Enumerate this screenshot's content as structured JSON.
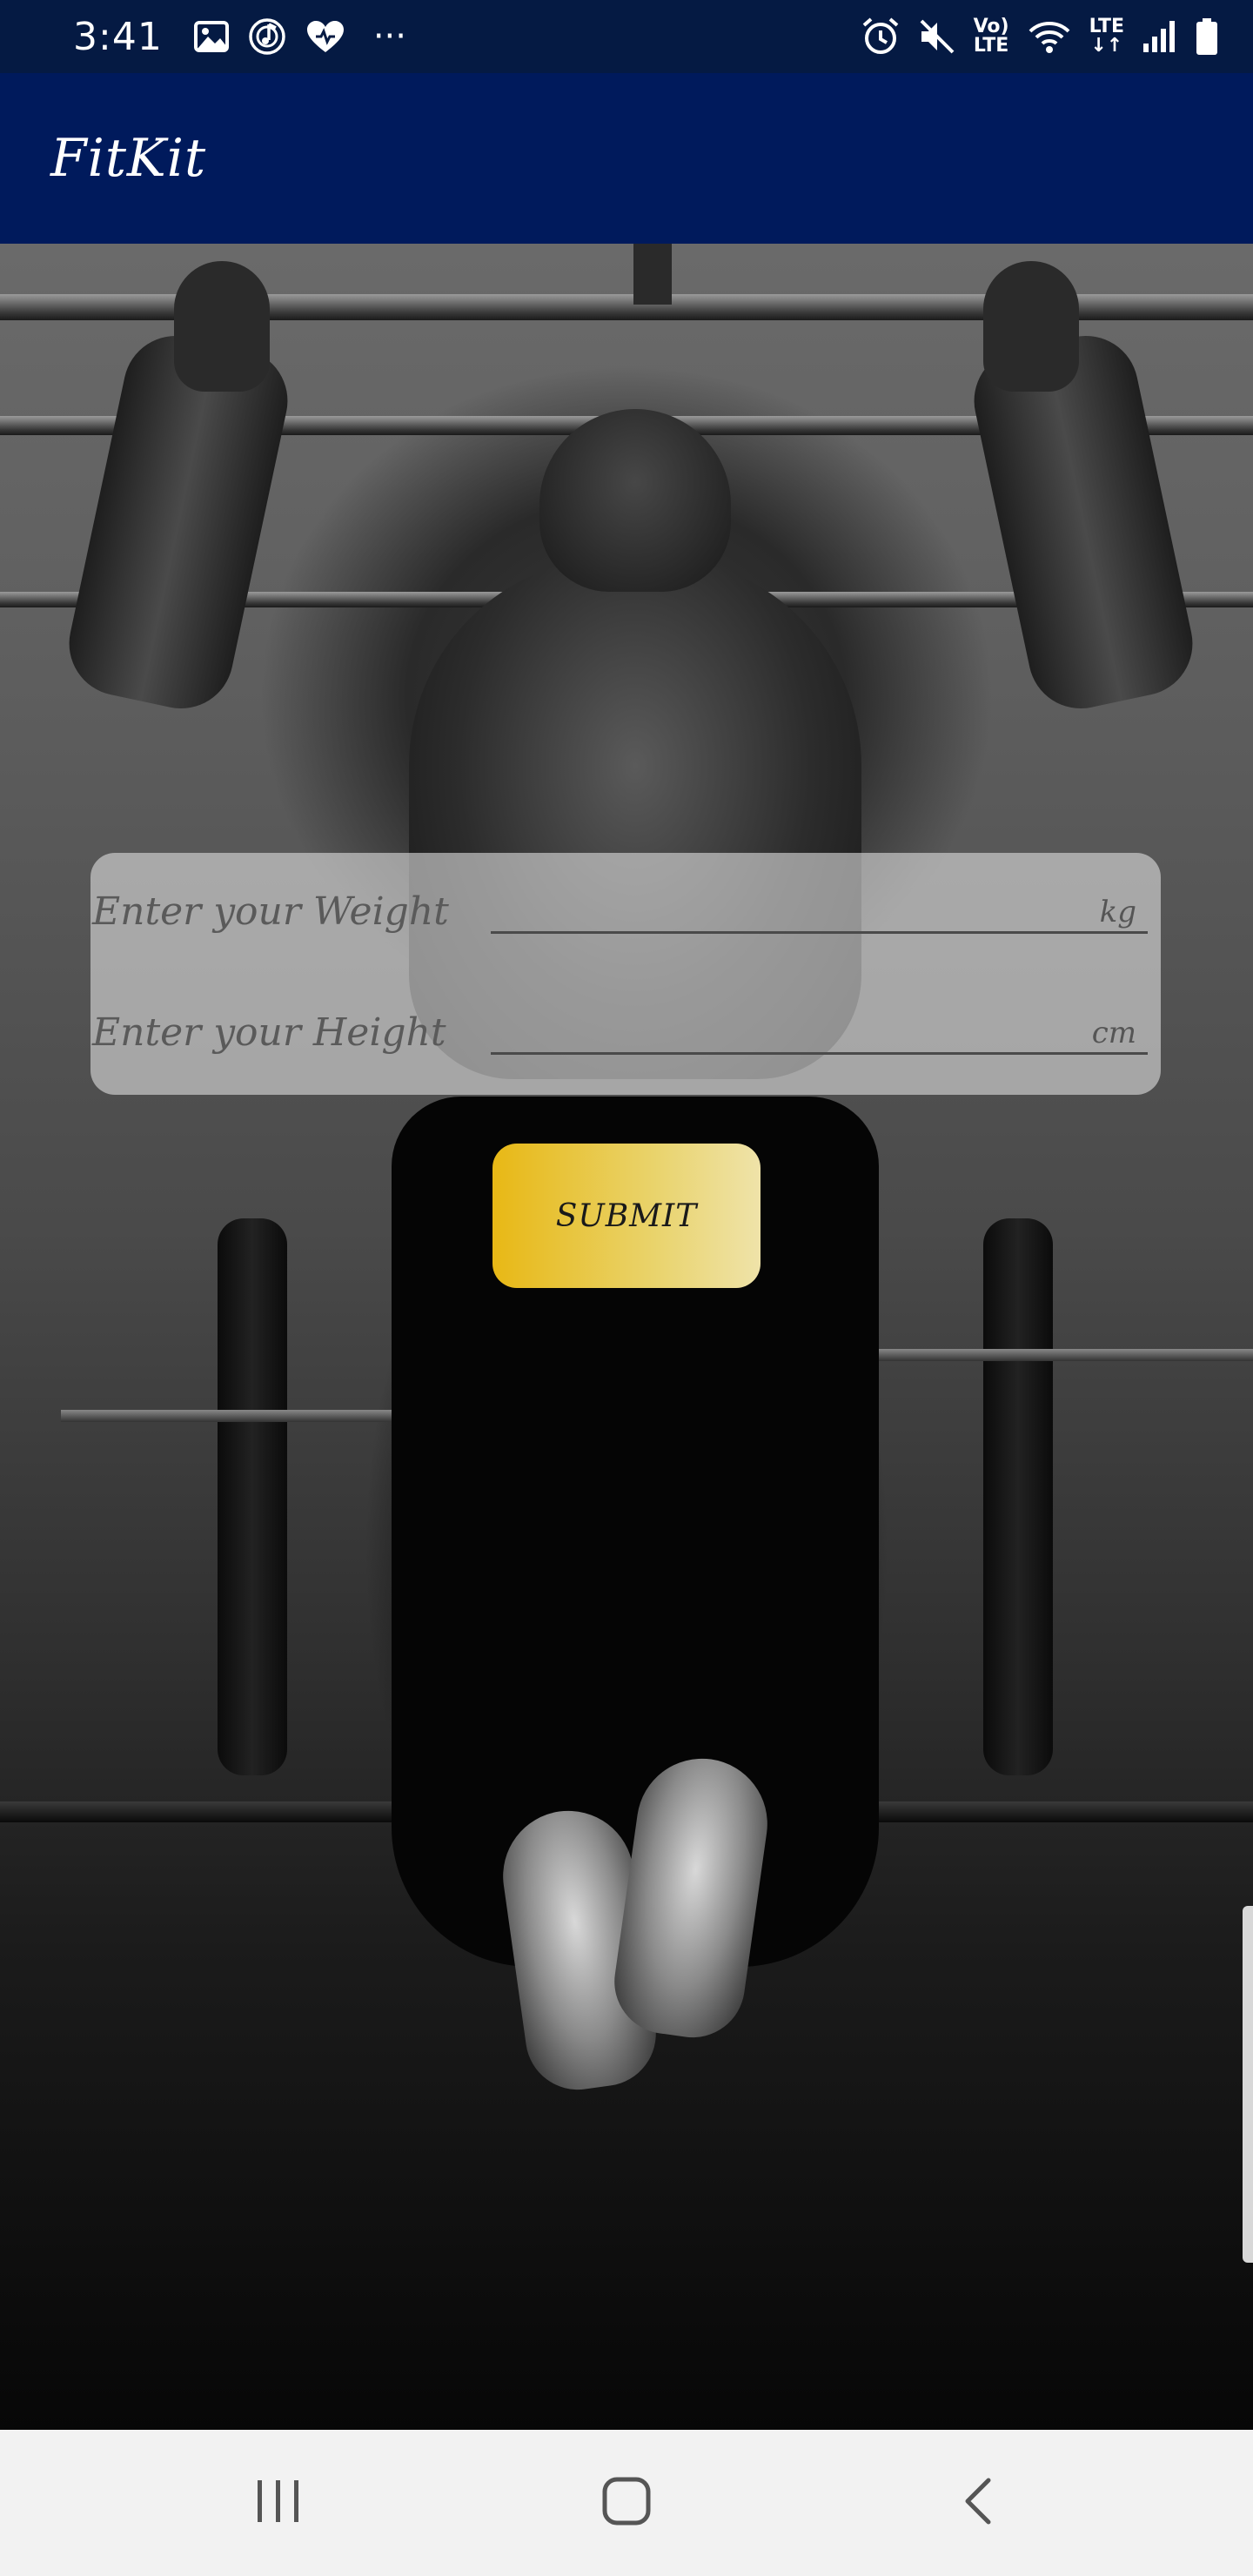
{
  "status_bar": {
    "time": "3:41",
    "more_label": "···",
    "volte_label_top": "Vo)",
    "volte_label_bottom": "LTE",
    "lte_label": "LTE"
  },
  "app_bar": {
    "title": "FitKit"
  },
  "form": {
    "weight": {
      "label": "Enter your Weight",
      "value": "",
      "unit": "kg"
    },
    "height": {
      "label": "Enter your Height",
      "value": "",
      "unit": "cm"
    }
  },
  "submit": {
    "label": "SUBMIT"
  },
  "colors": {
    "status_bar_bg": "#051a43",
    "app_bar_bg": "#001a5c",
    "button_gradient_start": "#e8b815",
    "button_gradient_end": "#efe3a9",
    "nav_bar_bg": "#f2f2f2"
  },
  "icons": {
    "status_left": [
      "image-icon",
      "music-icon",
      "health-icon",
      "more-icon"
    ],
    "status_right": [
      "alarm-icon",
      "mute-icon",
      "volte-icon",
      "wifi-icon",
      "lte-icon",
      "signal-icon",
      "battery-icon"
    ],
    "nav": [
      "recent-apps-icon",
      "home-icon",
      "back-icon"
    ]
  }
}
